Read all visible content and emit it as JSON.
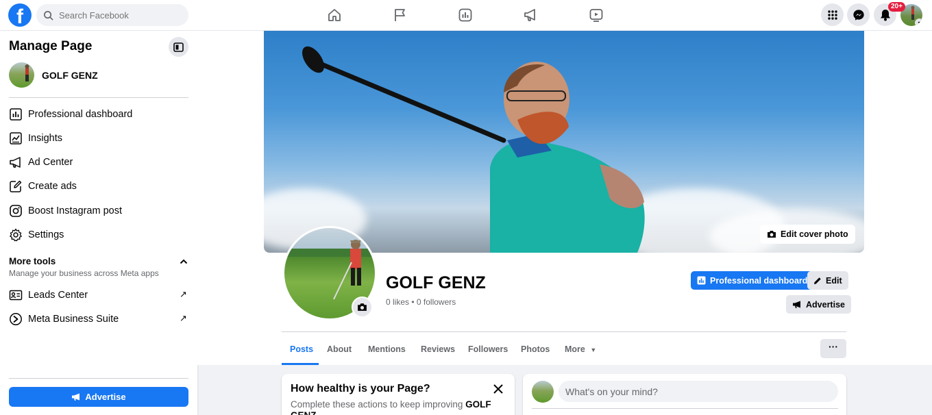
{
  "topbar": {
    "logo_letter": "f",
    "search_placeholder": "Search Facebook",
    "nav_icons": [
      "home-icon",
      "flag-icon",
      "insights-icon",
      "megaphone-icon",
      "video-icon"
    ],
    "right_icons": [
      "menu-grid-icon",
      "messenger-icon",
      "bell-icon"
    ],
    "notification_badge": "20+",
    "accent": "#1877f2"
  },
  "sidebar": {
    "title": "Manage Page",
    "page_name": "GOLF GENZ",
    "items": [
      {
        "label": "Professional dashboard",
        "icon": "dashboard-icon"
      },
      {
        "label": "Insights",
        "icon": "insights-icon"
      },
      {
        "label": "Ad Center",
        "icon": "megaphone-icon"
      },
      {
        "label": "Create ads",
        "icon": "pencil-icon"
      },
      {
        "label": "Boost Instagram post",
        "icon": "instagram-icon"
      },
      {
        "label": "Settings",
        "icon": "gear-icon"
      }
    ],
    "more_tools": {
      "title": "More tools",
      "subtitle": "Manage your business across Meta apps",
      "items": [
        {
          "label": "Leads Center",
          "icon": "contact-card-icon"
        },
        {
          "label": "Meta Business Suite",
          "icon": "meta-business-icon"
        }
      ]
    },
    "advertise_label": "Advertise"
  },
  "profile": {
    "edit_cover_label": "Edit cover photo",
    "name": "GOLF GENZ",
    "stats": "0 likes • 0 followers",
    "professional_dashboard_label": "Professional dashboard",
    "edit_label": "Edit",
    "advertise_label": "Advertise"
  },
  "tabs": [
    {
      "label": "Posts",
      "active": true
    },
    {
      "label": "About",
      "active": false
    },
    {
      "label": "Mentions",
      "active": false
    },
    {
      "label": "Reviews",
      "active": false
    },
    {
      "label": "Followers",
      "active": false
    },
    {
      "label": "Photos",
      "active": false
    },
    {
      "label": "More",
      "active": false
    }
  ],
  "more_dots": "···",
  "health_card": {
    "title": "How healthy is your Page?",
    "desc_prefix": "Complete these actions to keep improving ",
    "desc_page": "GOLF GENZ"
  },
  "composer": {
    "placeholder": "What's on your mind?"
  }
}
